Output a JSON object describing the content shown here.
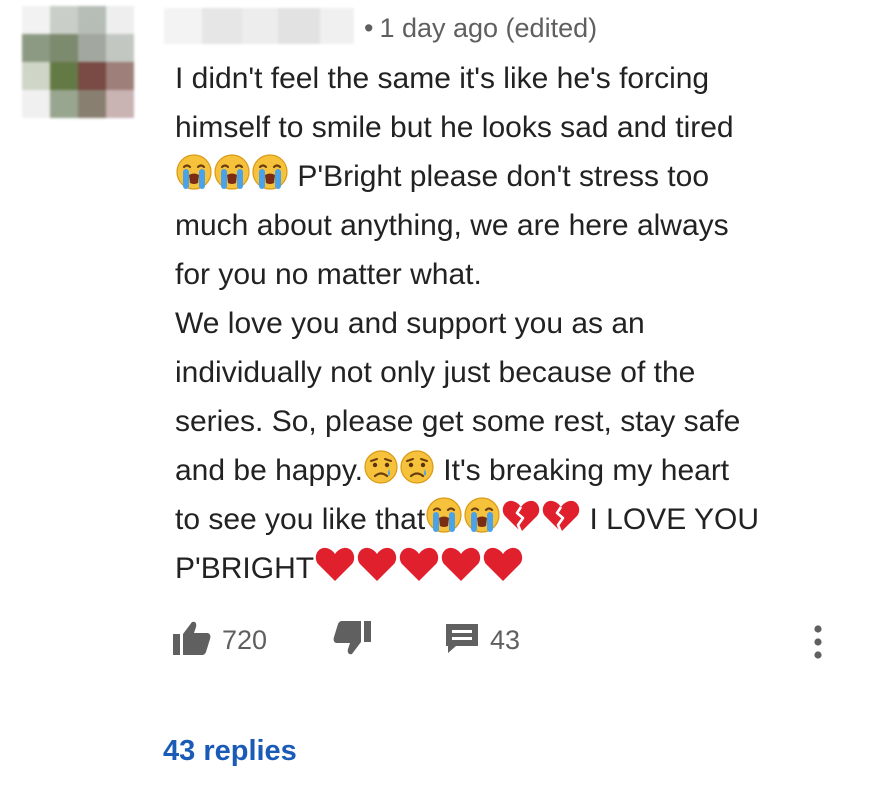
{
  "comment": {
    "meta": {
      "separator": "•",
      "timestamp": "1 day ago (edited)"
    },
    "lines": [
      "I didn't feel the same it's like he's forcing",
      "himself to smile but he looks sad and tired",
      " P'Bright please don't stress too",
      "much about anything, we are here always",
      "for you no matter what.",
      "We love you and support you as an",
      "individually not only just because of the",
      "series. So, please get some rest, stay safe",
      "and be happy.",
      " It's breaking my heart",
      "to see you like that",
      " I LOVE YOU",
      "P'BRIGHT"
    ],
    "emoji": {
      "crying": "loudly-crying-face",
      "sad": "crying-face",
      "broken_heart": "broken-heart",
      "heart": "red-heart"
    }
  },
  "actions": {
    "like_count": "720",
    "reply_count": "43"
  },
  "replies": {
    "label": "43 replies"
  },
  "colors": {
    "text": "#222222",
    "meta": "#5f5f5f",
    "icon": "#606060",
    "link": "#1a5bb8",
    "heart": "#e0202c"
  }
}
